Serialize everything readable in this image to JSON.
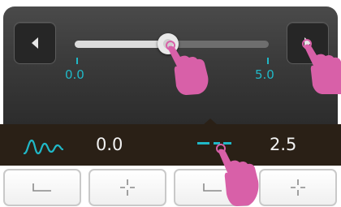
{
  "slider": {
    "value_fraction": 0.48,
    "min_label": "0.0",
    "max_label": "5.0"
  },
  "readout": {
    "left_value": "0.0",
    "right_value": "2.5"
  },
  "icons": {
    "nav_left": "triangle-left-icon",
    "nav_right": "triangle-right-icon",
    "waveform": "waveform-icon",
    "dash_level": "dashed-line-icon",
    "step_minus": "minus-icon",
    "step_plus": "plus-icon",
    "touch": "hand-pointer-icon"
  },
  "colors": {
    "accent": "#20b8c7",
    "readout_bg": "#2a2016",
    "hand": "#d860a8"
  }
}
